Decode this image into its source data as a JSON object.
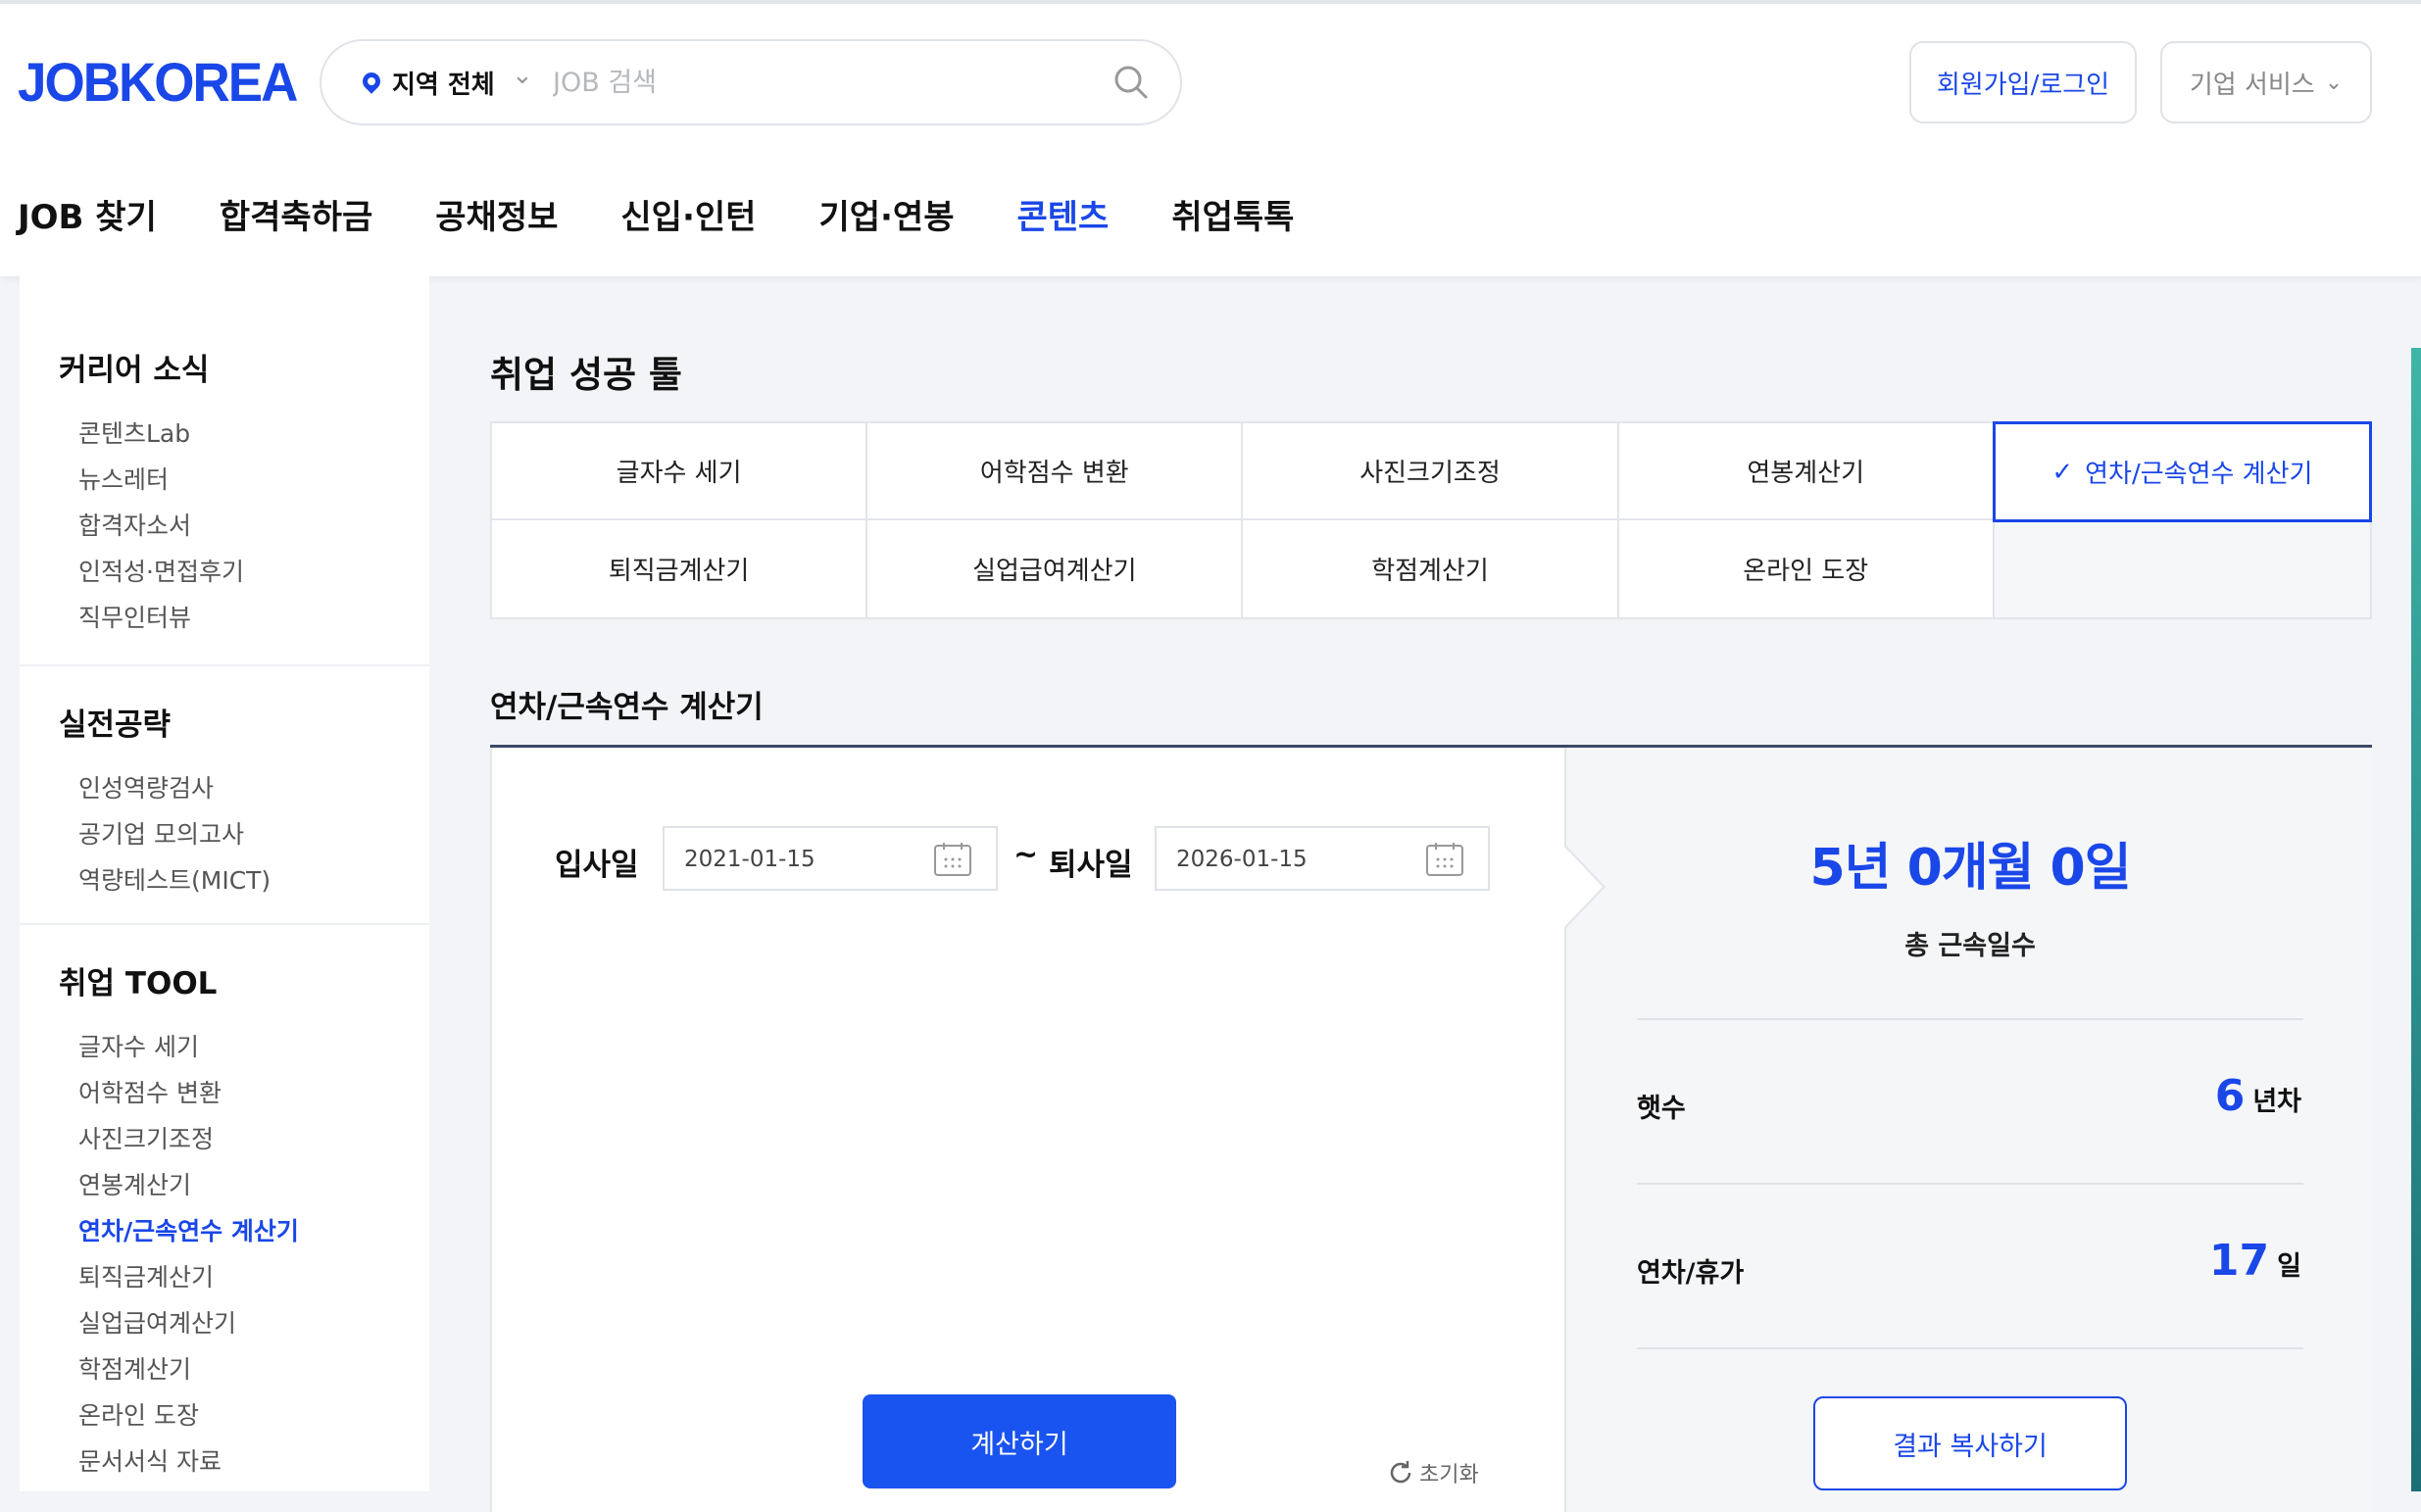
{
  "header": {
    "logo": "JOBKOREA",
    "region": "지역 전체",
    "search_placeholder": "JOB 검색",
    "signup_login": "회원가입/로그인",
    "business_service": "기업 서비스"
  },
  "gnb": [
    "JOB 찾기",
    "합격축하금",
    "공채정보",
    "신입·인턴",
    "기업·연봉",
    "콘텐츠",
    "취업톡톡"
  ],
  "gnb_active": "콘텐츠",
  "sidebar": {
    "groups": [
      {
        "title": "커리어 소식",
        "items": [
          "콘텐츠Lab",
          "뉴스레터",
          "합격자소서",
          "인적성·면접후기",
          "직무인터뷰"
        ]
      },
      {
        "title": "실전공략",
        "items": [
          "인성역량검사",
          "공기업 모의고사",
          "역량테스트(MICT)"
        ]
      },
      {
        "title": "취업 TOOL",
        "items": [
          "글자수 세기",
          "어학점수 변환",
          "사진크기조정",
          "연봉계산기",
          "연차/근속연수 계산기",
          "퇴직금계산기",
          "실업급여계산기",
          "학점계산기",
          "온라인 도장",
          "문서서식 자료"
        ]
      }
    ],
    "active_item": "연차/근속연수 계산기"
  },
  "main": {
    "page_title": "취업 성공 툴",
    "tabs": [
      "글자수 세기",
      "어학점수 변환",
      "사진크기조정",
      "연봉계산기",
      "연차/근속연수 계산기",
      "퇴직금계산기",
      "실업급여계산기",
      "학점계산기",
      "온라인 도장"
    ],
    "active_tab": "연차/근속연수 계산기",
    "calc_title": "연차/근속연수 계산기"
  },
  "calculator": {
    "start_label": "입사일",
    "start_date": "2021-01-15",
    "tilde": "~",
    "end_label": "퇴사일",
    "end_date": "2026-01-15",
    "calc_button": "계산하기",
    "reset": "초기화"
  },
  "result": {
    "duration": "5년 0개월 0일",
    "duration_label": "총 근속일수",
    "years_label": "햇수",
    "years_value": "6",
    "years_unit": "년차",
    "leave_label": "연차/휴가",
    "leave_value": "17",
    "leave_unit": "일",
    "copy_button": "결과 복사하기"
  },
  "colors": {
    "accent": "#1a47e8",
    "button": "#1a54f0"
  }
}
